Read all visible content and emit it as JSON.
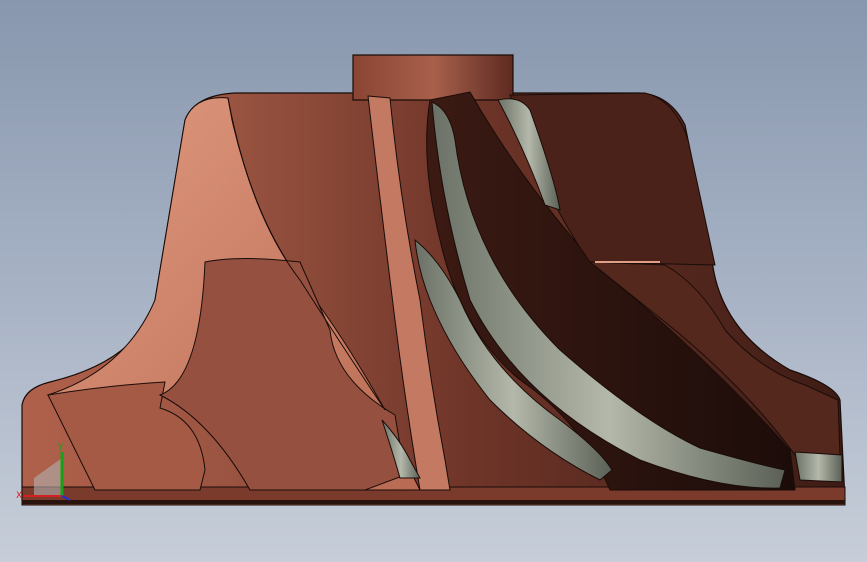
{
  "viewport": {
    "background_top": "#8897ae",
    "background_bottom": "#c7ced9"
  },
  "model": {
    "part": "impeller",
    "body_color": "#8e4a38",
    "highlight_color": "#d88b70",
    "shadow_color": "#3a1a14",
    "edge_color": "#1a0c08",
    "fillet_color": "#8a9080"
  },
  "triad": {
    "x_label": "X",
    "y_label": "Y",
    "x_color": "#d42020",
    "y_color": "#18a018",
    "z_color": "#2030d0"
  }
}
